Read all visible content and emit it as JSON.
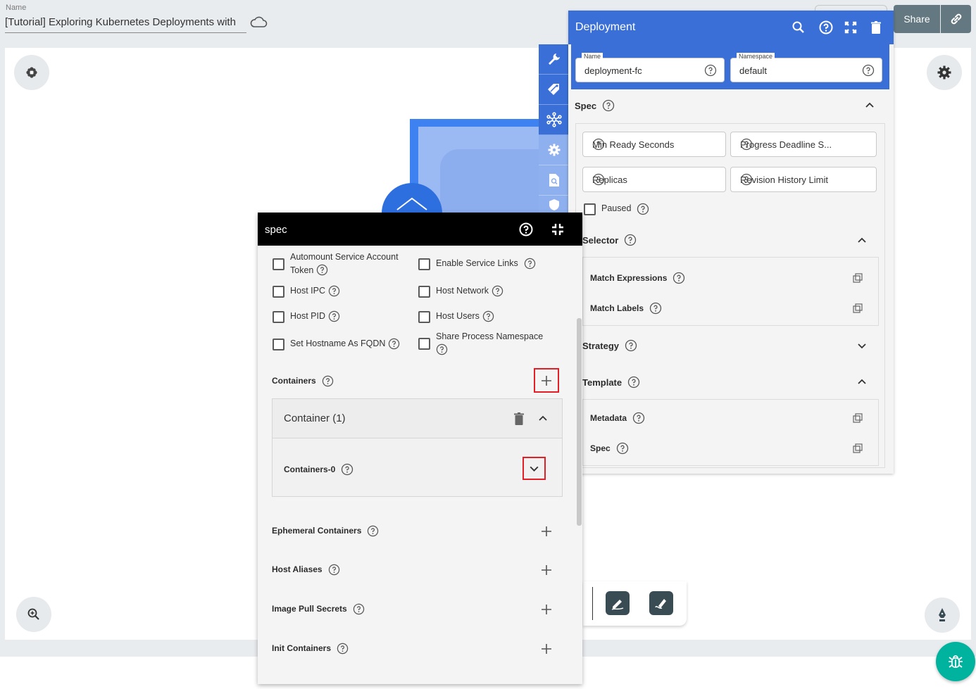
{
  "topbar": {
    "name_label": "Name",
    "design_name": "[Tutorial] Exploring Kubernetes Deployments with",
    "share_label": "Share"
  },
  "colors": {
    "accent_blue": "#3a6fd8",
    "spec_header": "#000000",
    "highlight_red": "#e41e26",
    "share_button": "#647881",
    "bug_button": "#00b39f"
  },
  "icons": {
    "cloud": "cloud-icon",
    "link": "link-icon",
    "canvas_left": "flower-icon",
    "canvas_right": "gear-icon",
    "zoom": "zoom-in-icon",
    "pen": "pen-icon",
    "bug": "bug-icon"
  },
  "rail": [
    "wrench-icon",
    "tag-icon",
    "network-icon",
    "gear-icon",
    "search-doc-icon",
    "shield-icon"
  ],
  "deployment": {
    "title": "Deployment",
    "name_field": {
      "label": "Name",
      "value": "deployment-fc"
    },
    "namespace_field": {
      "label": "Namespace",
      "value": "default"
    },
    "spec_label": "Spec",
    "spec_fields": [
      "Min Ready Seconds",
      "Progress Deadline S...",
      "Replicas",
      "Revision History Limit"
    ],
    "paused_label": "Paused",
    "selector_label": "Selector",
    "selector_items": [
      "Match Expressions",
      "Match Labels"
    ],
    "strategy_label": "Strategy",
    "template_label": "Template",
    "template_items": [
      "Metadata",
      "Spec"
    ]
  },
  "spec_panel": {
    "title": "spec",
    "checkboxes": {
      "automount": "Automount Service Account Token",
      "enable_service_links": "Enable Service Links",
      "host_ipc": "Host IPC",
      "host_network": "Host Network",
      "host_pid": "Host PID",
      "host_users": "Host Users",
      "set_hostname": "Set Hostname As FQDN",
      "share_process": "Share Process Namespace"
    },
    "containers_label": "Containers",
    "container_title": "Container (1)",
    "container_item": "Containers-0",
    "ephemeral_label": "Ephemeral Containers",
    "host_aliases_label": "Host Aliases",
    "image_pull_label": "Image Pull Secrets",
    "init_containers_label": "Init Containers"
  }
}
